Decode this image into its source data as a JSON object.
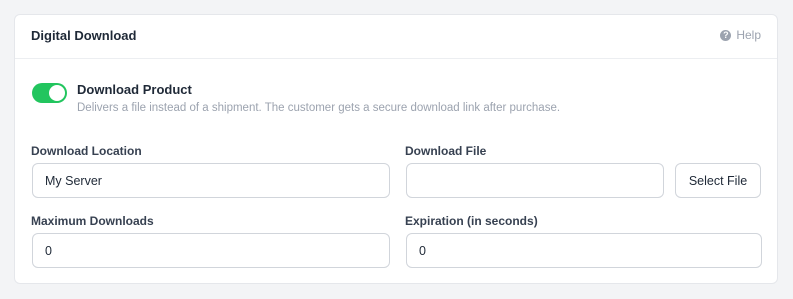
{
  "card": {
    "title": "Digital Download",
    "help_label": "Help",
    "help_icon": "question-circle-icon"
  },
  "download_product": {
    "enabled": true,
    "label": "Download Product",
    "description": "Delivers a file instead of a shipment. The customer gets a secure download link after purchase.",
    "toggle_color": "#22c55e"
  },
  "fields": {
    "download_location": {
      "label": "Download Location",
      "value": "My Server"
    },
    "download_file": {
      "label": "Download File",
      "value": "",
      "button_label": "Select File"
    },
    "maximum_downloads": {
      "label": "Maximum Downloads",
      "value": "0"
    },
    "expiration": {
      "label": "Expiration (in seconds)",
      "value": "0"
    }
  }
}
